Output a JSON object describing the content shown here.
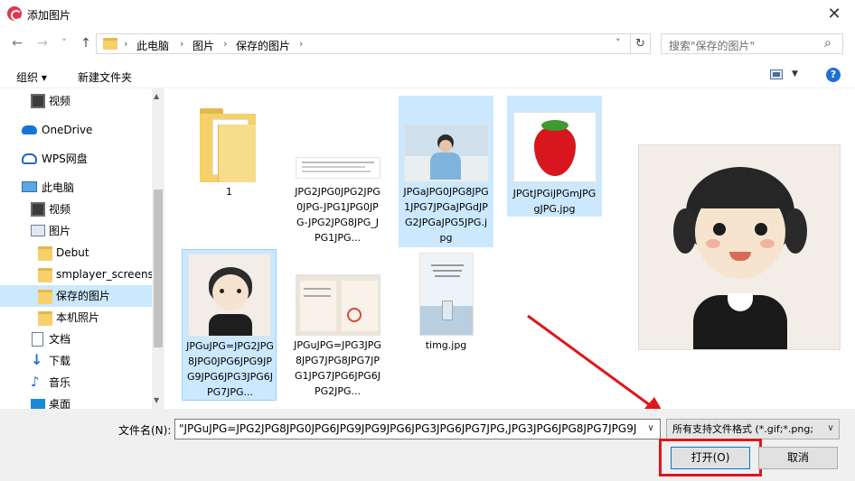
{
  "window": {
    "title": "添加图片",
    "close_glyph": "✕"
  },
  "nav": {
    "back_glyph": "←",
    "forward_glyph": "→",
    "recent_glyph": "˅",
    "up_glyph": "↑",
    "breadcrumb": [
      "此电脑",
      "图片",
      "保存的图片"
    ],
    "sep_glyph": "›",
    "address_dropdown_glyph": "˅",
    "refresh_glyph": "↻",
    "search_placeholder": "搜索\"保存的图片\"",
    "search_glyph": "⌕"
  },
  "toolbar": {
    "organize_label": "组织 ▾",
    "new_folder_label": "新建文件夹",
    "help_glyph": "?"
  },
  "sidebar": {
    "items": [
      {
        "label": "视频",
        "icon": "video-icon"
      },
      {
        "label": "OneDrive",
        "icon": "cloud-icon"
      },
      {
        "label": "WPS网盘",
        "icon": "wps-cloud-icon"
      },
      {
        "label": "此电脑",
        "icon": "computer-icon"
      },
      {
        "label": "视频",
        "icon": "video-icon"
      },
      {
        "label": "图片",
        "icon": "pictures-icon"
      },
      {
        "label": "Debut",
        "icon": "folder-icon"
      },
      {
        "label": "smplayer_screensl",
        "icon": "folder-icon"
      },
      {
        "label": "保存的图片",
        "icon": "folder-icon"
      },
      {
        "label": "本机照片",
        "icon": "folder-icon"
      },
      {
        "label": "文档",
        "icon": "document-icon"
      },
      {
        "label": "下载",
        "icon": "download-icon"
      },
      {
        "label": "音乐",
        "icon": "music-icon"
      },
      {
        "label": "桌面",
        "icon": "desktop-icon"
      }
    ],
    "scroll_up_glyph": "▲",
    "scroll_down_glyph": "▼"
  },
  "files": [
    {
      "name": "1",
      "kind": "folder"
    },
    {
      "name": "JPG2JPG0JPG2JPG0JPG-JPG1JPG0JPG-JPG2JPG8JPG_JPG1JPG...",
      "kind": "doc"
    },
    {
      "name": "JPGaJPG0JPG8JPG1JPG7JPGaJPGdJPG2JPGaJPG5JPG.jpg",
      "kind": "photo-boy"
    },
    {
      "name": "JPGtJPGiJPGmJPGgJPG.jpg",
      "kind": "strawberry"
    },
    {
      "name": "JPGuJPG=JPG2JPG8JPG0JPG6JPG9JPG9JPG6JPG3JPG6JPG7JPG...",
      "kind": "girl-sketch"
    },
    {
      "name": "JPGuJPG=JPG3JPG8JPG7JPG8JPG7JPG1JPG7JPG6JPG6JPG2JPG...",
      "kind": "certificate"
    },
    {
      "name": "timg.jpg",
      "kind": "poster"
    }
  ],
  "bottom": {
    "filename_label": "文件名(N):",
    "filename_value": "\"JPGuJPG=JPG2JPG8JPG0JPG6JPG9JPG9JPG6JPG3JPG6JPG7JPG,JPG3JPG6JPG8JPG7JPG9J",
    "filetype_value": "所有支持文件格式 (*.gif;*.png;",
    "dropdown_glyph": "∨",
    "open_label": "打开(O)",
    "cancel_label": "取消"
  },
  "colors": {
    "selection": "#cce8ff",
    "annotation": "#e0161b",
    "accent": "#0078d7"
  }
}
